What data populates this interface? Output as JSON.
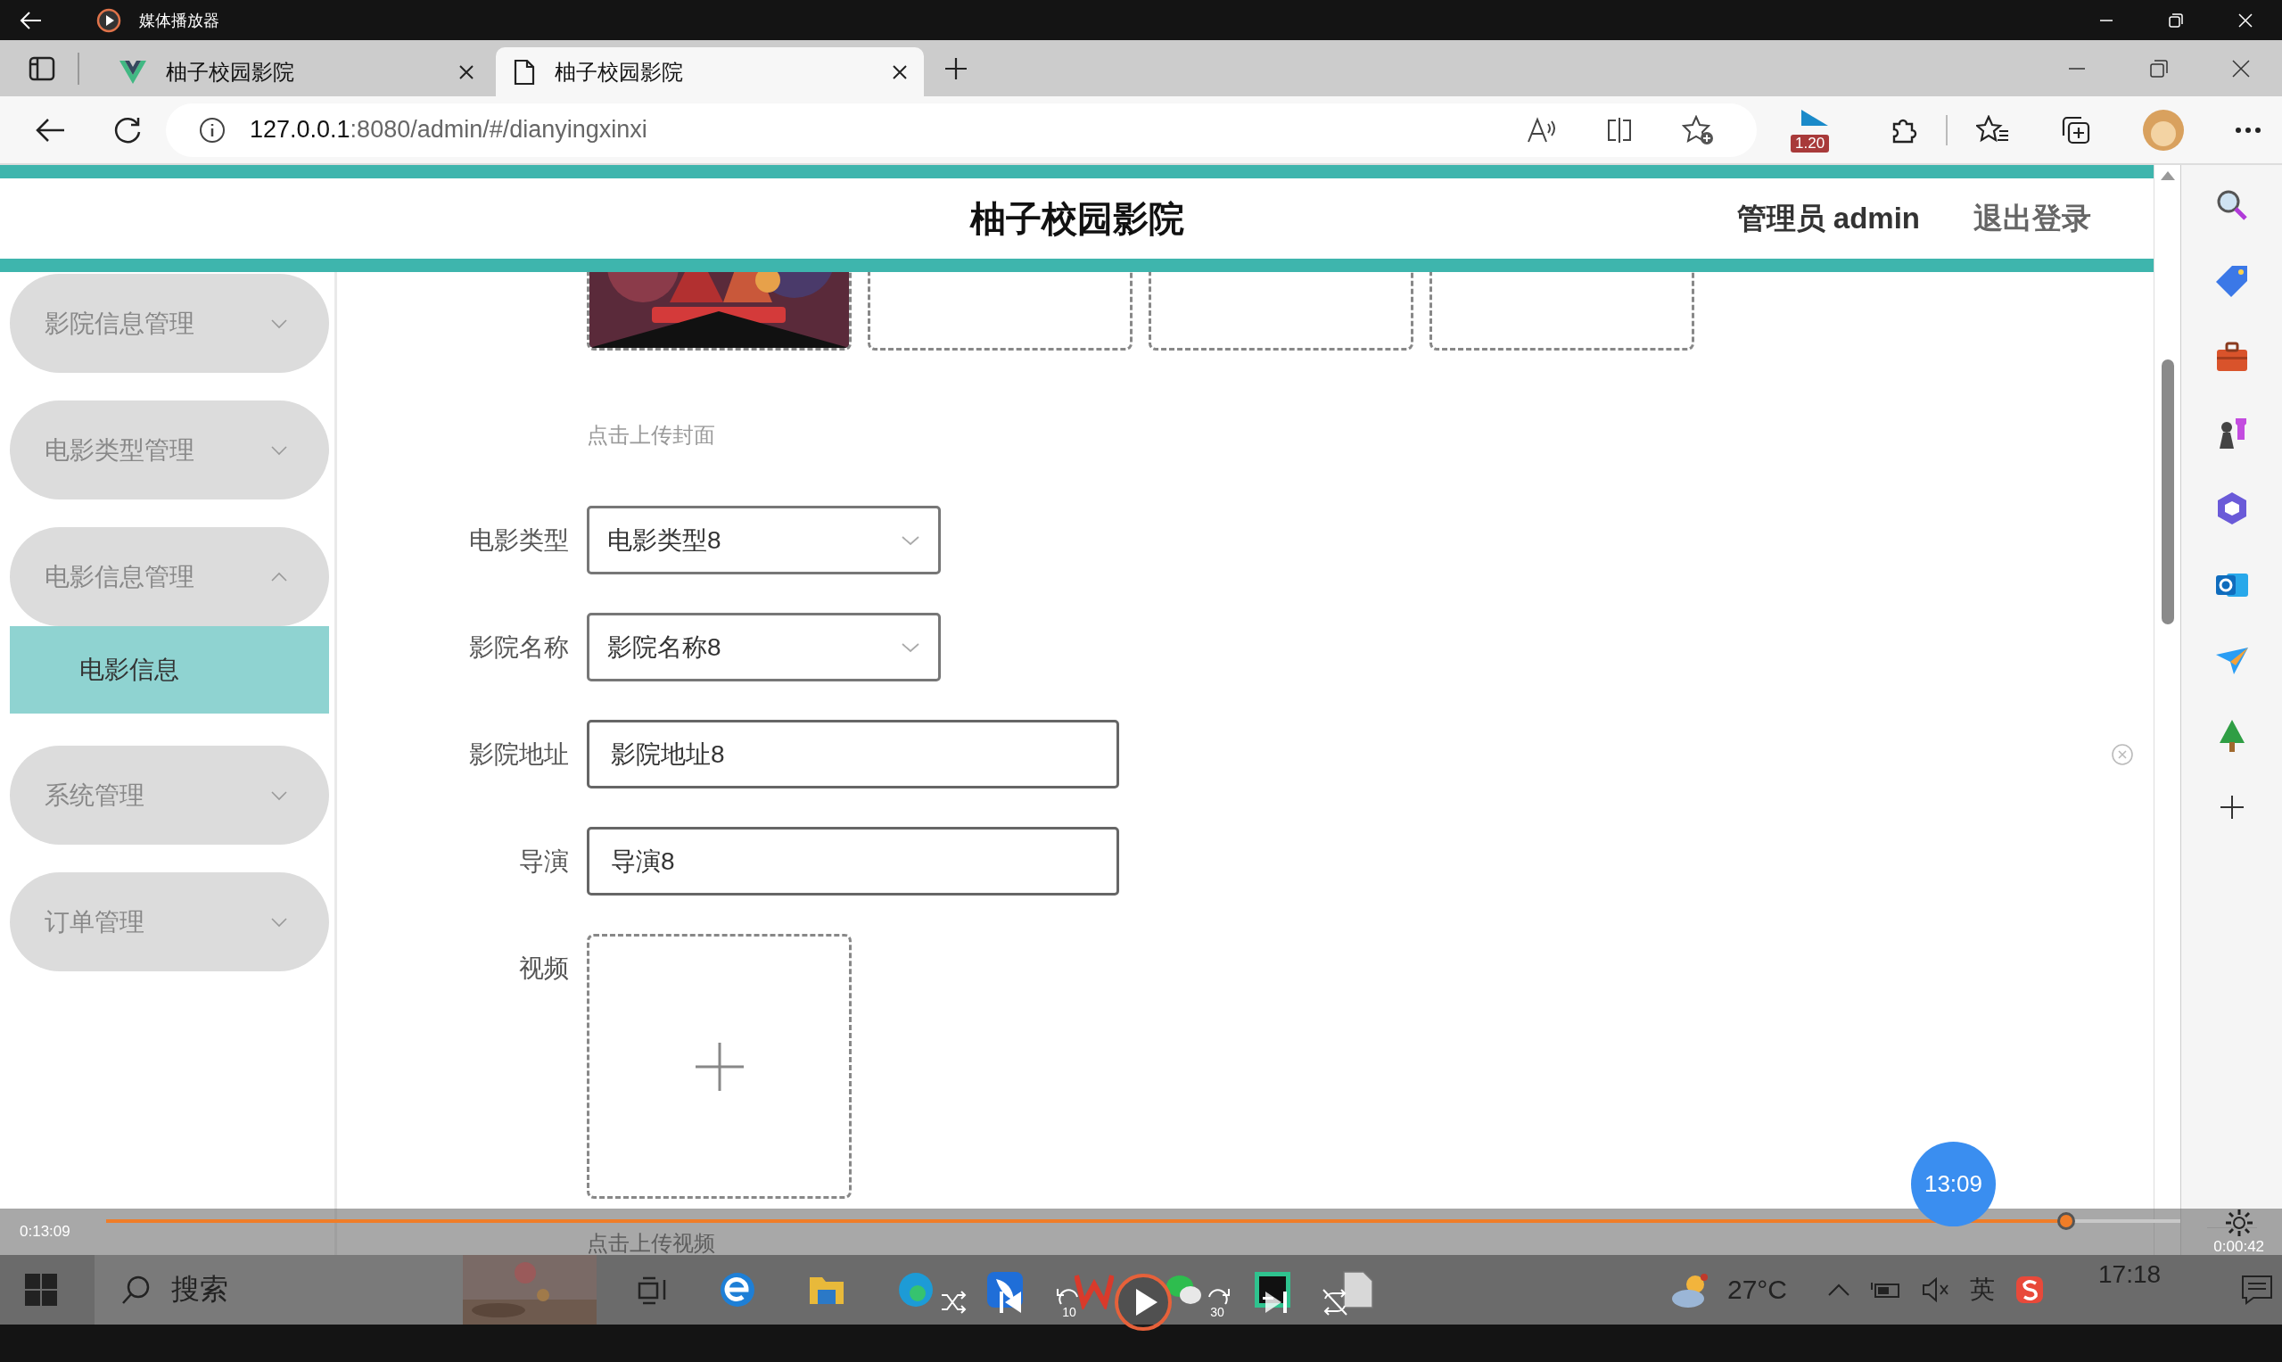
{
  "media_player": {
    "title": "媒体播放器",
    "elapsed": "0:13:09",
    "remaining": "0:00:42",
    "level": 0.945,
    "time_bubble": "13:09",
    "skip_back": "10",
    "skip_forward": "30",
    "playing": false
  },
  "browser": {
    "tabs": [
      {
        "title": "柚子校园影院",
        "selected": false
      },
      {
        "title": "柚子校园影院",
        "selected": true
      }
    ],
    "url_host": "127.0.0.1",
    "url_path": ":8080/admin/#/dianyingxinxi",
    "extension_badge": "1.20"
  },
  "page": {
    "site_title": "柚子校园影院",
    "user": "管理员 admin",
    "logout": "退出登录",
    "menu": [
      {
        "label": "影院信息管理",
        "expanded": false
      },
      {
        "label": "电影类型管理",
        "expanded": false
      },
      {
        "label": "电影信息管理",
        "expanded": true,
        "children": [
          {
            "label": "电影信息",
            "selected": true
          }
        ]
      },
      {
        "label": "系统管理",
        "expanded": false
      },
      {
        "label": "订单管理",
        "expanded": false
      }
    ],
    "covers": [
      {
        "kind": "picture"
      },
      {
        "kind": "empty"
      },
      {
        "kind": "empty"
      },
      {
        "kind": "empty"
      }
    ],
    "cover_hint": "点击上传封面",
    "fields": [
      {
        "kind": "select",
        "label": "电影类型",
        "value": "电影类型8"
      },
      {
        "kind": "select",
        "label": "影院名称",
        "value": "影院名称8"
      },
      {
        "kind": "text",
        "label": "影院地址",
        "value": "影院地址8"
      },
      {
        "kind": "text",
        "label": "导演",
        "value": "导演8"
      },
      {
        "kind": "upload",
        "label": "视频"
      }
    ],
    "video_hint": "点击上传视频"
  },
  "taskbar": {
    "search": "搜索",
    "weather": "27°C",
    "ime": "英",
    "time": "17:18"
  }
}
